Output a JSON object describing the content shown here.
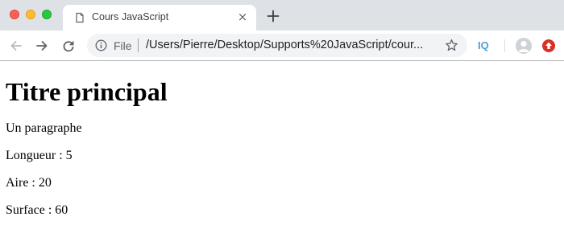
{
  "tab": {
    "title": "Cours JavaScript"
  },
  "omnibox": {
    "scheme_label": "File",
    "url": "/Users/Pierre/Desktop/Supports%20JavaScript/cour..."
  },
  "extensions": {
    "iq_label": "IQ"
  },
  "page": {
    "heading": "Titre principal",
    "paragraphs": [
      "Un paragraphe",
      "Longueur : 5",
      "Aire : 20",
      "Surface : 60"
    ]
  },
  "icons": {
    "tab": "document-icon",
    "close": "close-icon",
    "new_tab": "plus-icon",
    "back": "back-arrow-icon",
    "forward": "forward-arrow-icon",
    "reload": "reload-icon",
    "info": "info-icon",
    "star": "star-icon",
    "avatar": "avatar-icon",
    "red_extension": "red-extension-icon"
  },
  "colors": {
    "tabstrip": "#dee1e6",
    "close_dot": "#fe5f57",
    "minimize_dot": "#febc2e",
    "zoom_dot": "#28c840",
    "iq_blue": "#4a9fd8",
    "extension_red": "#d93025"
  }
}
